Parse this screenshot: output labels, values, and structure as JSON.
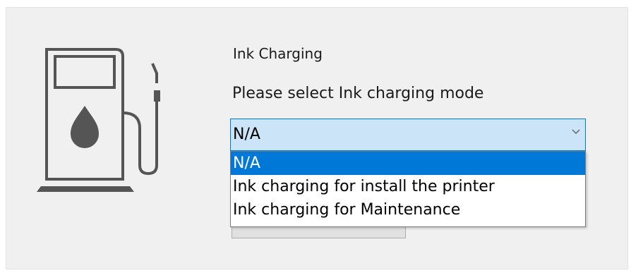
{
  "heading": {
    "title": "Ink Charging",
    "prompt": "Please select Ink charging mode"
  },
  "mode_select": {
    "value": "N/A",
    "expanded": true,
    "options": [
      {
        "label": "N/A",
        "selected": true
      },
      {
        "label": "Ink charging for install the printer",
        "selected": false
      },
      {
        "label": "Ink charging for Maintenance",
        "selected": false
      }
    ]
  },
  "icons": {
    "pump": "fuel-pump-ink-drop-icon",
    "dropdown_arrow": "chevron-down-icon"
  },
  "colors": {
    "panel_background": "#f0f0f0",
    "accent": "#0078d7",
    "select_highlight": "#cce4f7",
    "icon_gray": "#555555"
  }
}
